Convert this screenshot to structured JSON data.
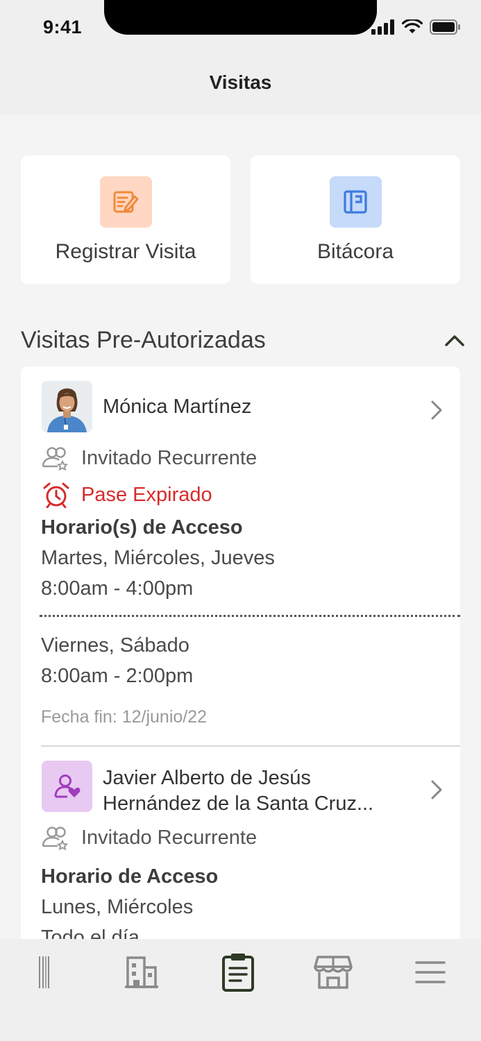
{
  "status_bar": {
    "time": "9:41"
  },
  "header": {
    "title": "Visitas"
  },
  "quick_actions": [
    {
      "label": "Registrar Visita",
      "icon": "edit-form-icon",
      "icon_bg": "#ffd7c2",
      "icon_color": "#f08a3c"
    },
    {
      "label": "Bitácora",
      "icon": "logbook-icon",
      "icon_bg": "#c6dafa",
      "icon_color": "#3e7be0"
    }
  ],
  "section": {
    "title": "Visitas Pre-Autorizadas",
    "collapse_icon": "chevron-up-icon"
  },
  "visitors": [
    {
      "name": "Mónica Martínez",
      "type": "Invitado Recurrente",
      "status": "Pase Expirado",
      "schedule_title": "Horario(s) de Acceso",
      "schedules": [
        {
          "days": "Martes, Miércoles, Jueves",
          "hours": "8:00am - 4:00pm"
        },
        {
          "days": "Viernes, Sábado",
          "hours": "8:00am - 2:00pm"
        }
      ],
      "end_date": "Fecha fin: 12/junio/22"
    },
    {
      "name_line1": "Javier Alberto de Jesús",
      "name_line2": "Hernández de la Santa Cruz...",
      "type": "Invitado Recurrente",
      "schedule_title": "Horario de Acceso",
      "days": "Lunes, Miércoles",
      "hours": "Todo el día"
    }
  ],
  "tabs": [
    {
      "icon": "barcode-icon"
    },
    {
      "icon": "building-icon"
    },
    {
      "icon": "clipboard-icon",
      "active": true
    },
    {
      "icon": "store-icon"
    },
    {
      "icon": "menu-icon"
    }
  ],
  "colors": {
    "accent": "#2f3a26",
    "expired": "#d62b2b"
  }
}
